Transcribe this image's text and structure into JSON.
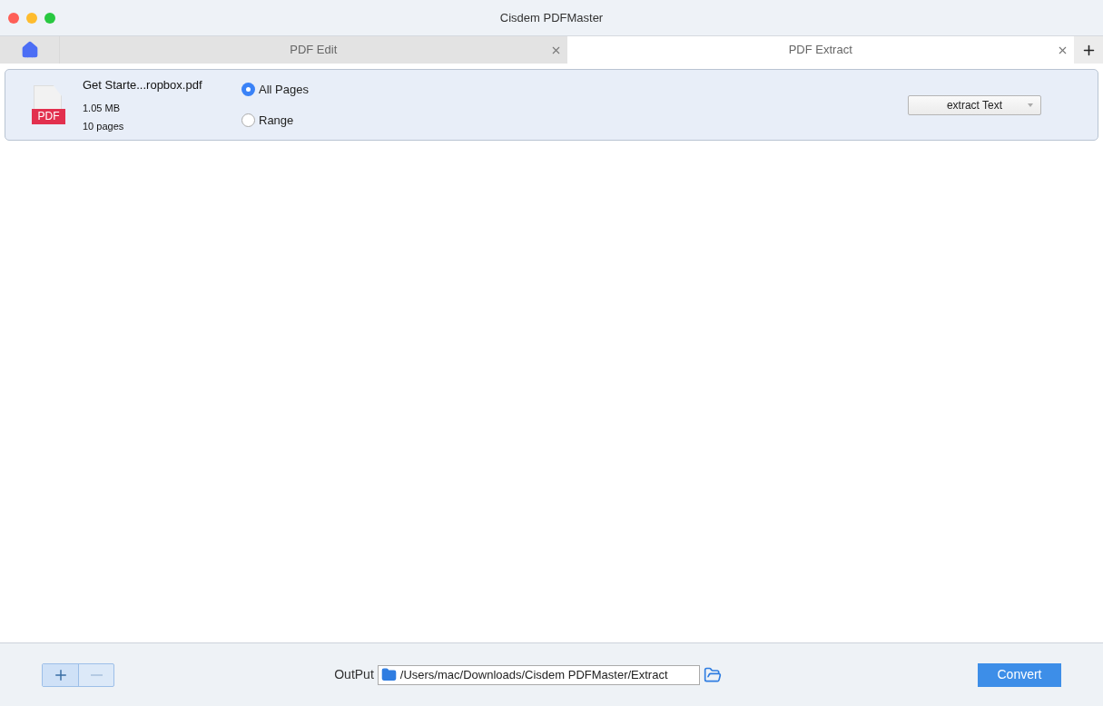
{
  "window": {
    "title": "Cisdem PDFMaster"
  },
  "tabs": [
    {
      "label": "PDF Edit",
      "selected": false
    },
    {
      "label": "PDF Extract",
      "selected": true
    }
  ],
  "files": [
    {
      "name": "Get Starte...ropbox.pdf",
      "badge": "PDF",
      "size": "1.05 MB",
      "pages": "10 pages",
      "page_options": [
        {
          "label": "All Pages",
          "selected": true
        },
        {
          "label": "Range",
          "selected": false
        }
      ],
      "mode": "extract Text"
    }
  ],
  "footer": {
    "add_disabled": false,
    "remove_disabled": true,
    "output_label": "OutPut",
    "output_path": "/Users/mac/Downloads/Cisdem PDFMaster/Extract",
    "convert": "Convert"
  }
}
